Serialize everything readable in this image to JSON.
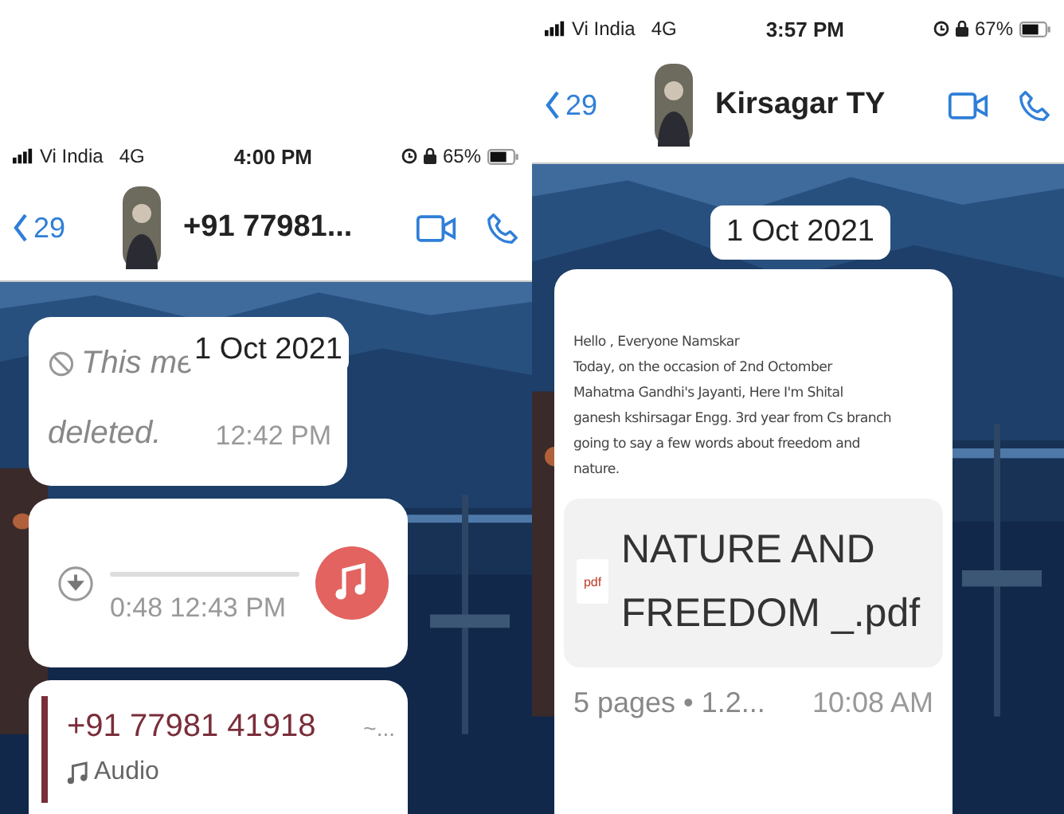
{
  "screens": [
    {
      "status_bar": {
        "carrier": "Vi India",
        "network": "4G",
        "time": "4:00 PM",
        "battery": "65%"
      },
      "header": {
        "back_count": "29",
        "contact": "+91 77981..."
      },
      "date_pill": "1 Oct 2021",
      "messages": [
        {
          "kind": "deleted",
          "lines": [
            "This me",
            "deleted."
          ],
          "time": "12:42 PM"
        },
        {
          "kind": "audio",
          "duration": "0:48",
          "time": "12:43 PM"
        },
        {
          "kind": "reply",
          "sender": "+91 77981 41918",
          "sender_suffix": "~...",
          "quoted": "Audio"
        }
      ]
    },
    {
      "status_bar": {
        "carrier": "Vi India",
        "network": "4G",
        "time": "3:57 PM",
        "battery": "67%"
      },
      "header": {
        "back_count": "29",
        "contact": "Kirsagar TY"
      },
      "date_pill": "1 Oct 2021",
      "messages": [
        {
          "kind": "document",
          "lines": [
            "Hello , Everyone Namskar",
            "Today, on the occasion of 2nd Octomber",
            "Mahatma Gandhi's Jayanti, Here I'm Shital",
            "ganesh kshirsagar Engg. 3rd year from Cs branch",
            "going to say a few words about freedom and",
            "nature."
          ],
          "file_type": "pdf",
          "file_name": "NATURE AND FREEDOM _.pdf",
          "meta": "5 pages • 1.2...",
          "time": "10:08 AM"
        }
      ]
    }
  ]
}
